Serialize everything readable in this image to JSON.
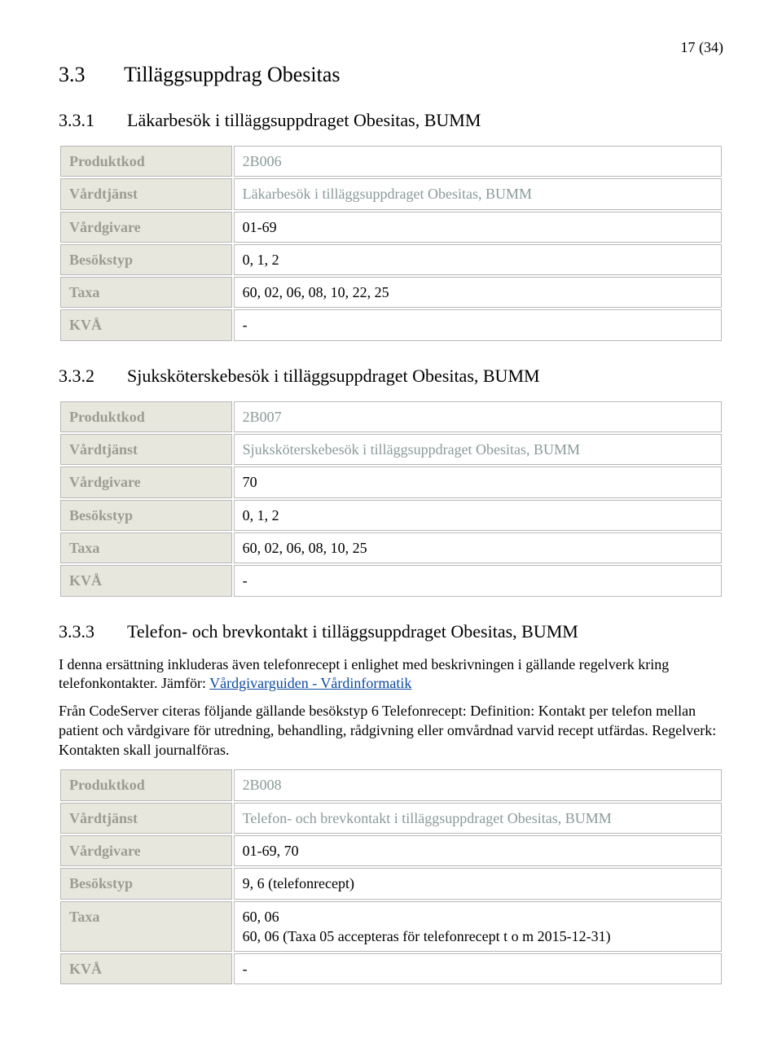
{
  "page_number": "17 (34)",
  "heading_main": {
    "num": "3.3",
    "title": "Tilläggsuppdrag Obesitas"
  },
  "sections": [
    {
      "heading": {
        "num": "3.3.1",
        "title": "Läkarbesök i tilläggsuppdraget Obesitas, BUMM"
      },
      "table": [
        {
          "label": "Produktkod",
          "value": "2B006",
          "muted": true
        },
        {
          "label": "Vårdtjänst",
          "value": "Läkarbesök i tilläggsuppdraget Obesitas, BUMM",
          "muted": true
        },
        {
          "label": "Vårdgivare",
          "value": "01-69"
        },
        {
          "label": "Besökstyp",
          "value": "0, 1, 2"
        },
        {
          "label": "Taxa",
          "value": "60, 02, 06, 08, 10, 22, 25"
        },
        {
          "label": "KVÅ",
          "value": "-"
        }
      ]
    },
    {
      "heading": {
        "num": "3.3.2",
        "title": "Sjuksköterskebesök i tilläggsuppdraget Obesitas, BUMM"
      },
      "table": [
        {
          "label": "Produktkod",
          "value": "2B007",
          "muted": true
        },
        {
          "label": "Vårdtjänst",
          "value": "Sjuksköterskebesök i tilläggsuppdraget Obesitas, BUMM",
          "muted": true
        },
        {
          "label": "Vårdgivare",
          "value": "70"
        },
        {
          "label": "Besökstyp",
          "value": "0, 1, 2"
        },
        {
          "label": "Taxa",
          "value": "60, 02, 06, 08, 10, 25"
        },
        {
          "label": "KVÅ",
          "value": "-"
        }
      ]
    },
    {
      "heading": {
        "num": "3.3.3",
        "title": "Telefon- och brevkontakt i tilläggsuppdraget Obesitas, BUMM"
      },
      "para_before_link": "I denna ersättning inkluderas även telefonrecept i enlighet med beskrivningen i gällande regelverk kring telefonkontakter. Jämför: ",
      "link_text": "Vårdgivarguiden - Vårdinformatik",
      "para_after_link": "Från CodeServer citeras följande gällande besökstyp 6 Telefonrecept: Definition: Kontakt per telefon mellan patient och vårdgivare för utredning, behandling, rådgivning eller omvårdnad varvid recept utfärdas. Regelverk: Kontakten skall journalföras.",
      "table": [
        {
          "label": "Produktkod",
          "value": "2B008",
          "muted": true
        },
        {
          "label": "Vårdtjänst",
          "value": "Telefon- och brevkontakt i tilläggsuppdraget Obesitas, BUMM",
          "muted": true
        },
        {
          "label": "Vårdgivare",
          "value": "01-69, 70"
        },
        {
          "label": "Besökstyp",
          "value": "9, 6 (telefonrecept)"
        },
        {
          "label": "Taxa",
          "value": "60, 06\n60, 06 (Taxa 05 accepteras för telefonrecept t o m 2015-12-31)"
        },
        {
          "label": "KVÅ",
          "value": "-"
        }
      ]
    }
  ]
}
